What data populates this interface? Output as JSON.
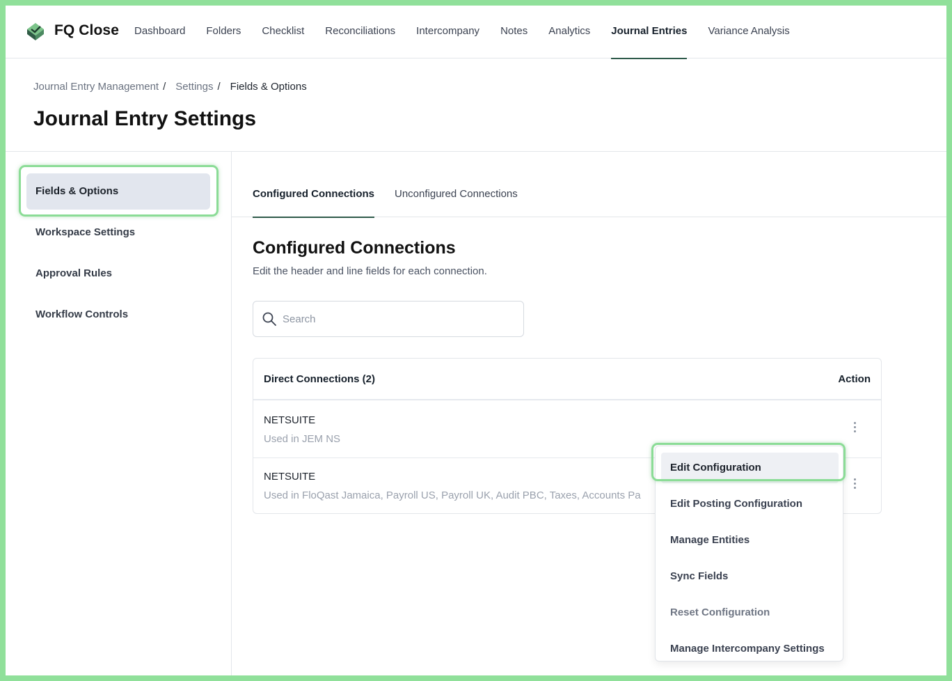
{
  "brand": "FQ Close",
  "nav": [
    {
      "label": "Dashboard"
    },
    {
      "label": "Folders"
    },
    {
      "label": "Checklist"
    },
    {
      "label": "Reconciliations"
    },
    {
      "label": "Intercompany"
    },
    {
      "label": "Notes"
    },
    {
      "label": "Analytics"
    },
    {
      "label": "Journal Entries",
      "active": true
    },
    {
      "label": "Variance Analysis"
    }
  ],
  "breadcrumb": {
    "item1": "Journal Entry Management",
    "item2": "Settings",
    "current": "Fields & Options",
    "sep": "/"
  },
  "page_title": "Journal Entry Settings",
  "sidebar": {
    "items": [
      {
        "label": "Fields & Options",
        "active": true
      },
      {
        "label": "Workspace Settings"
      },
      {
        "label": "Approval Rules"
      },
      {
        "label": "Workflow Controls"
      }
    ]
  },
  "tabs": [
    {
      "label": "Configured Connections",
      "active": true
    },
    {
      "label": "Unconfigured Connections"
    }
  ],
  "section": {
    "title": "Configured Connections",
    "subtitle": "Edit the header and line fields for each connection."
  },
  "search": {
    "placeholder": "Search",
    "value": ""
  },
  "table": {
    "header": "Direct Connections (2)",
    "action_header": "Action",
    "rows": [
      {
        "name": "NETSUITE",
        "used": "Used in JEM NS"
      },
      {
        "name": "NETSUITE",
        "used": "Used in FloQast Jamaica, Payroll US, Payroll UK, Audit PBC, Taxes, Accounts Pa"
      }
    ]
  },
  "menu": {
    "items": [
      {
        "label": "Edit Configuration"
      },
      {
        "label": "Edit Posting Configuration"
      },
      {
        "label": "Manage Entities"
      },
      {
        "label": "Sync Fields"
      },
      {
        "label": "Reset Configuration"
      },
      {
        "label": "Manage Intercompany Settings"
      }
    ]
  },
  "colors": {
    "accent": "#2e5a4a",
    "highlight": "#8bdc96",
    "frame": "#90e09a"
  }
}
